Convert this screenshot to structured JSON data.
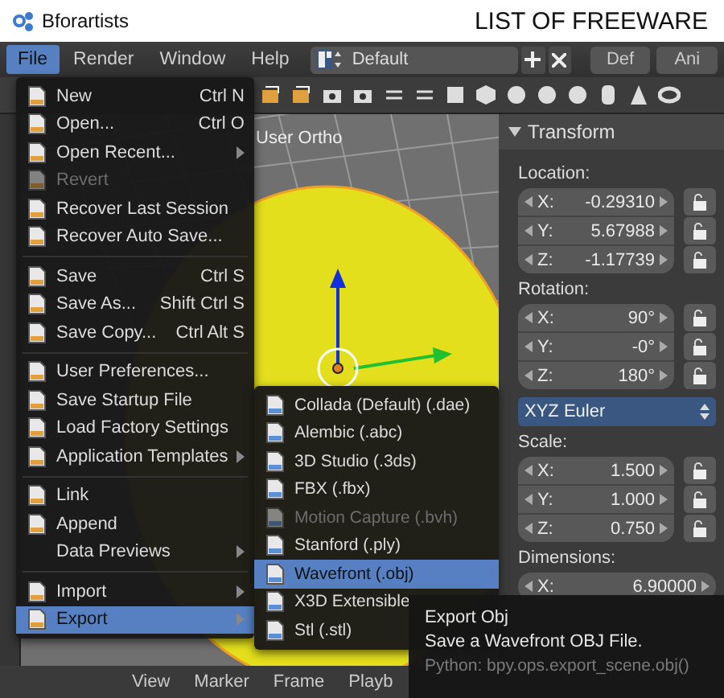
{
  "app": {
    "name": "Bforartists",
    "caption": "LIST OF FREEWARE"
  },
  "menubar": {
    "menus": [
      {
        "label": "File",
        "selected": true
      },
      {
        "label": "Render",
        "selected": false
      },
      {
        "label": "Window",
        "selected": false
      },
      {
        "label": "Help",
        "selected": false
      }
    ],
    "layout": {
      "value": "Default"
    },
    "workspaces": [
      {
        "label": "Def"
      },
      {
        "label": "Ani"
      }
    ]
  },
  "viewport": {
    "label": "User Ortho"
  },
  "file_menu": {
    "items": [
      {
        "kind": "item",
        "label": "New",
        "shortcut": "Ctrl N",
        "icon": true,
        "submenu": false,
        "disabled": false,
        "selected": false
      },
      {
        "kind": "item",
        "label": "Open...",
        "shortcut": "Ctrl O",
        "icon": true,
        "submenu": false,
        "disabled": false,
        "selected": false
      },
      {
        "kind": "item",
        "label": "Open Recent...",
        "icon": true,
        "submenu": true,
        "disabled": false,
        "selected": false
      },
      {
        "kind": "item",
        "label": "Revert",
        "icon": true,
        "submenu": false,
        "disabled": true,
        "selected": false
      },
      {
        "kind": "item",
        "label": "Recover Last Session",
        "icon": true,
        "submenu": false,
        "disabled": false,
        "selected": false
      },
      {
        "kind": "item",
        "label": "Recover Auto Save...",
        "icon": true,
        "submenu": false,
        "disabled": false,
        "selected": false
      },
      {
        "kind": "separator"
      },
      {
        "kind": "item",
        "label": "Save",
        "shortcut": "Ctrl S",
        "icon": true,
        "submenu": false,
        "disabled": false,
        "selected": false
      },
      {
        "kind": "item",
        "label": "Save As...",
        "shortcut": "Shift Ctrl S",
        "icon": true,
        "submenu": false,
        "disabled": false,
        "selected": false
      },
      {
        "kind": "item",
        "label": "Save Copy...",
        "shortcut": "Ctrl Alt S",
        "icon": true,
        "submenu": false,
        "disabled": false,
        "selected": false
      },
      {
        "kind": "separator"
      },
      {
        "kind": "item",
        "label": "User Preferences...",
        "icon": true,
        "submenu": false,
        "disabled": false,
        "selected": false
      },
      {
        "kind": "item",
        "label": "Save Startup File",
        "icon": true,
        "submenu": false,
        "disabled": false,
        "selected": false
      },
      {
        "kind": "item",
        "label": "Load Factory Settings",
        "icon": true,
        "submenu": false,
        "disabled": false,
        "selected": false
      },
      {
        "kind": "item",
        "label": "Application Templates",
        "icon": true,
        "submenu": true,
        "disabled": false,
        "selected": false
      },
      {
        "kind": "separator"
      },
      {
        "kind": "item",
        "label": "Link",
        "icon": true,
        "submenu": false,
        "disabled": false,
        "selected": false
      },
      {
        "kind": "item",
        "label": "Append",
        "icon": true,
        "submenu": false,
        "disabled": false,
        "selected": false
      },
      {
        "kind": "item",
        "label": "Data Previews",
        "icon": false,
        "submenu": true,
        "disabled": false,
        "selected": false
      },
      {
        "kind": "separator"
      },
      {
        "kind": "item",
        "label": "Import",
        "icon": true,
        "submenu": true,
        "disabled": false,
        "selected": false
      },
      {
        "kind": "item",
        "label": "Export",
        "icon": true,
        "submenu": true,
        "disabled": false,
        "selected": true
      }
    ]
  },
  "export_menu": {
    "items": [
      {
        "label": "Collada (Default) (.dae)",
        "disabled": false,
        "selected": false
      },
      {
        "label": "Alembic (.abc)",
        "disabled": false,
        "selected": false
      },
      {
        "label": "3D Studio (.3ds)",
        "disabled": false,
        "selected": false
      },
      {
        "label": "FBX (.fbx)",
        "disabled": false,
        "selected": false
      },
      {
        "label": "Motion Capture (.bvh)",
        "disabled": true,
        "selected": false
      },
      {
        "label": "Stanford (.ply)",
        "disabled": false,
        "selected": false
      },
      {
        "label": "Wavefront (.obj)",
        "disabled": false,
        "selected": true
      },
      {
        "label": "X3D Extensible",
        "disabled": false,
        "selected": false
      },
      {
        "label": "Stl (.stl)",
        "disabled": false,
        "selected": false
      }
    ]
  },
  "tooltip": {
    "title": "Export Obj",
    "description": "Save a Wavefront OBJ File.",
    "python": "Python: bpy.ops.export_scene.obj()"
  },
  "transform_panel": {
    "title": "Transform",
    "sections": [
      {
        "kind": "vector",
        "label": "Location:",
        "lockable": true,
        "fields": [
          {
            "axis": "X:",
            "value": "-0.29310"
          },
          {
            "axis": "Y:",
            "value": "5.67988"
          },
          {
            "axis": "Z:",
            "value": "-1.17739"
          }
        ]
      },
      {
        "kind": "vector",
        "label": "Rotation:",
        "lockable": true,
        "fields": [
          {
            "axis": "X:",
            "value": "90°"
          },
          {
            "axis": "Y:",
            "value": "-0°"
          },
          {
            "axis": "Z:",
            "value": "180°"
          }
        ]
      },
      {
        "kind": "dropdown",
        "value": "XYZ Euler"
      },
      {
        "kind": "vector",
        "label": "Scale:",
        "lockable": true,
        "fields": [
          {
            "axis": "X:",
            "value": "1.500"
          },
          {
            "axis": "Y:",
            "value": "1.000"
          },
          {
            "axis": "Z:",
            "value": "0.750"
          }
        ]
      },
      {
        "kind": "vector",
        "label": "Dimensions:",
        "lockable": false,
        "fields": [
          {
            "axis": "X:",
            "value": "6.90000"
          }
        ]
      }
    ]
  },
  "bottom_bar": {
    "items": [
      "View",
      "Marker",
      "Frame",
      "Playb"
    ]
  }
}
